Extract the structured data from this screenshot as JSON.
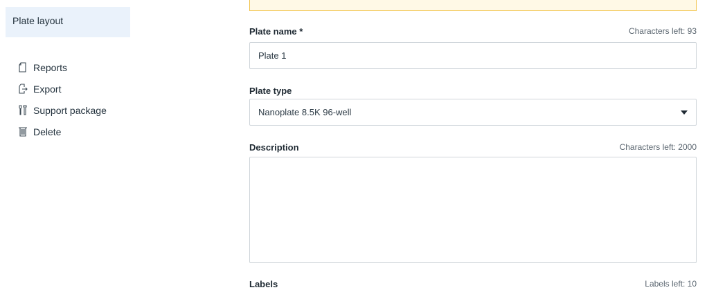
{
  "sidebar": {
    "active_item": "Plate layout",
    "items": [
      {
        "label": "Reports",
        "icon": "document-icon"
      },
      {
        "label": "Export",
        "icon": "export-icon"
      },
      {
        "label": "Support package",
        "icon": "tools-icon"
      },
      {
        "label": "Delete",
        "icon": "trash-icon"
      }
    ]
  },
  "form": {
    "plate_name": {
      "label": "Plate name *",
      "counter": "Characters left: 93",
      "value": "Plate 1"
    },
    "plate_type": {
      "label": "Plate type",
      "selected": "Nanoplate 8.5K 96-well"
    },
    "description": {
      "label": "Description",
      "counter": "Characters left: 2000",
      "value": ""
    },
    "labels": {
      "label": "Labels",
      "counter": "Labels left: 10"
    }
  },
  "colors": {
    "sidebar_active_bg": "#eaf2fb",
    "alert_border": "#f2c44d",
    "input_border": "#cfd5da"
  }
}
